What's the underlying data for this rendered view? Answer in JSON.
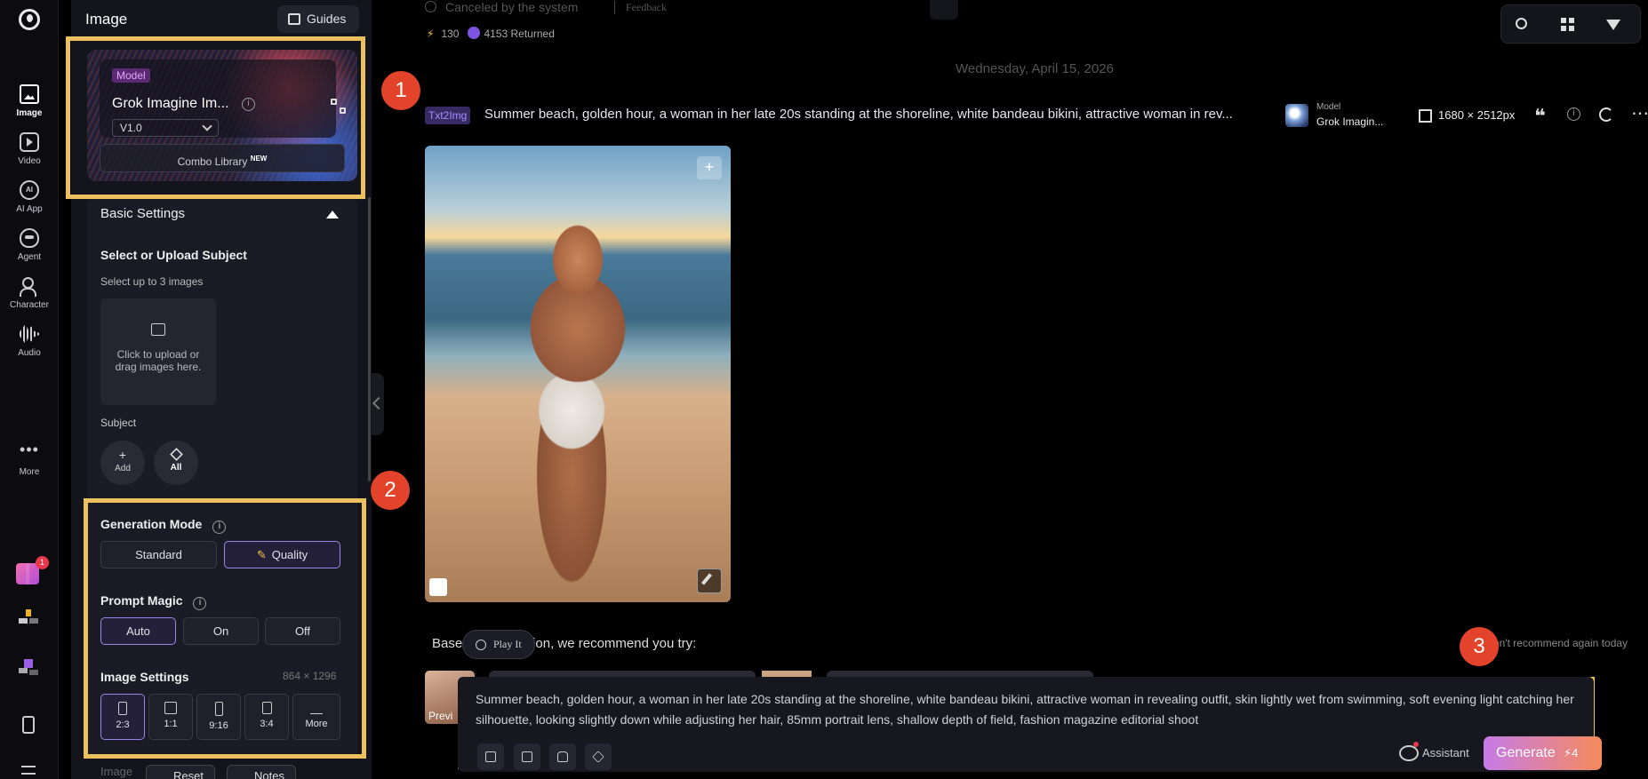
{
  "rail": {
    "items": [
      {
        "label": "Image",
        "icon": "image-icon",
        "active": true
      },
      {
        "label": "Video",
        "icon": "video-icon"
      },
      {
        "label": "AI App",
        "icon": "ai-app-icon"
      },
      {
        "label": "Agent",
        "icon": "agent-icon"
      },
      {
        "label": "Character",
        "icon": "character-icon"
      },
      {
        "label": "Audio",
        "icon": "audio-icon"
      },
      {
        "label": "More",
        "icon": "more-icon"
      }
    ],
    "gift_badge": "1"
  },
  "panel": {
    "title": "Image",
    "guides_label": "Guides",
    "model": {
      "tag": "Model",
      "name": "Grok Imagine Im...",
      "version": "V1.0",
      "combo_label": "Combo Library",
      "combo_badge": "NEW"
    },
    "basic_settings": "Basic Settings",
    "subject_title": "Select or Upload Subject",
    "subject_hint": "Select up to 3 images",
    "upload_text": "Click to upload or drag images here.",
    "subject_label": "Subject",
    "add_label": "Add",
    "add_glyph": "+",
    "all_label": "All",
    "generation_mode": {
      "title": "Generation Mode",
      "options": [
        "Standard",
        "Quality"
      ],
      "selected": "Quality"
    },
    "prompt_magic": {
      "title": "Prompt Magic",
      "options": [
        "Auto",
        "On",
        "Off"
      ],
      "selected": "Auto"
    },
    "image_settings": {
      "title": "Image Settings",
      "size": "864 × 1296",
      "ratios": [
        "2:3",
        "1:1",
        "9:16",
        "3:4",
        "More"
      ],
      "selected": "2:3"
    },
    "section_cut": "Image",
    "reset_label": "Reset",
    "notes_label": "Notes"
  },
  "badges": [
    "1",
    "2",
    "3"
  ],
  "main": {
    "status": "Canceled by the system",
    "feedback": "Feedback",
    "credits": "130",
    "returned": "4153 Returned",
    "date": "Wednesday, April 15, 2026",
    "task": {
      "tag": "Txt2Img",
      "prompt": "Summer beach, golden hour, a woman in her late 20s standing at the shoreline, white bandeau bikini, attractive woman in rev...",
      "model_tag": "Model",
      "model_name": "Grok Imagin...",
      "size": "1680 × 2512px"
    },
    "recommend_start": "Base",
    "recommend_end": "eation, we recommend you try:",
    "play_it": "Play It",
    "dont_recommend": "on't recommend again today",
    "preview_label": "Previ",
    "prompt_input": "Summer beach, golden hour, a woman in her late 20s standing at the shoreline, white bandeau bikini, attractive woman in revealing outfit, skin lightly wet from swimming, soft evening light catching her silhouette, looking slightly down while adjusting her hair, 85mm portrait lens, shallow depth of field, fashion magazine editorial shoot",
    "assistant_label": "Assistant",
    "generate_label": "Generate",
    "generate_cost": "⚡4"
  },
  "colors": {
    "highlight": "#ecc05e",
    "badge": "#e2432a",
    "accent": "#9a86e6"
  }
}
